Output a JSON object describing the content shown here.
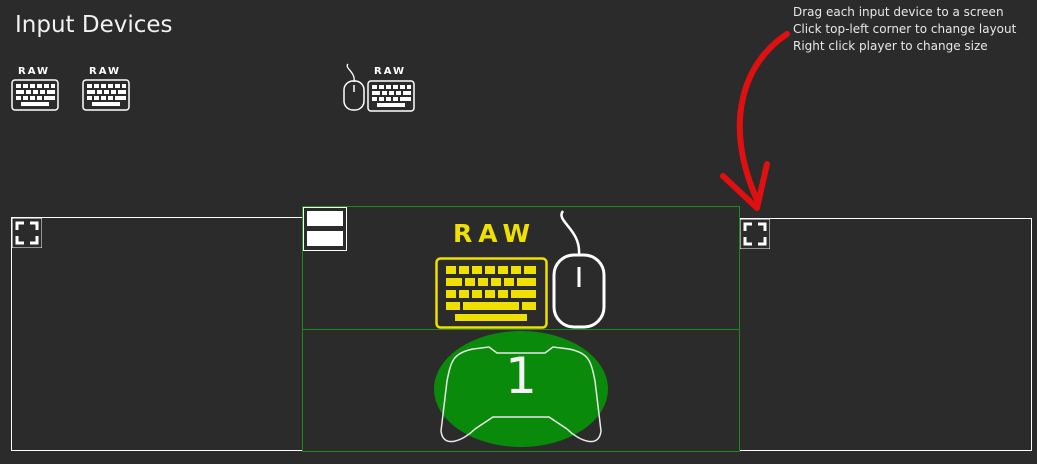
{
  "title": "Input Devices",
  "hints": [
    "Drag each input device to a screen",
    "Click top-left corner to change layout",
    "Right click player to change size"
  ],
  "devices": [
    {
      "type": "keyboard",
      "label": "RAW"
    },
    {
      "type": "keyboard",
      "label": "RAW"
    },
    {
      "type": "keyboard-mouse",
      "label": "RAW"
    }
  ],
  "screens": {
    "left": {
      "icon": "fullscreen-corner-icon"
    },
    "right": {
      "icon": "fullscreen-corner-icon"
    },
    "center": {
      "input_label": "RAW",
      "player_number": "1",
      "accent_color": "#f0e000",
      "player_color": "#0a8a0a"
    }
  },
  "colors": {
    "background": "#2b2b2b",
    "active_border": "#1e8a1e",
    "arrow": "#e01010"
  }
}
